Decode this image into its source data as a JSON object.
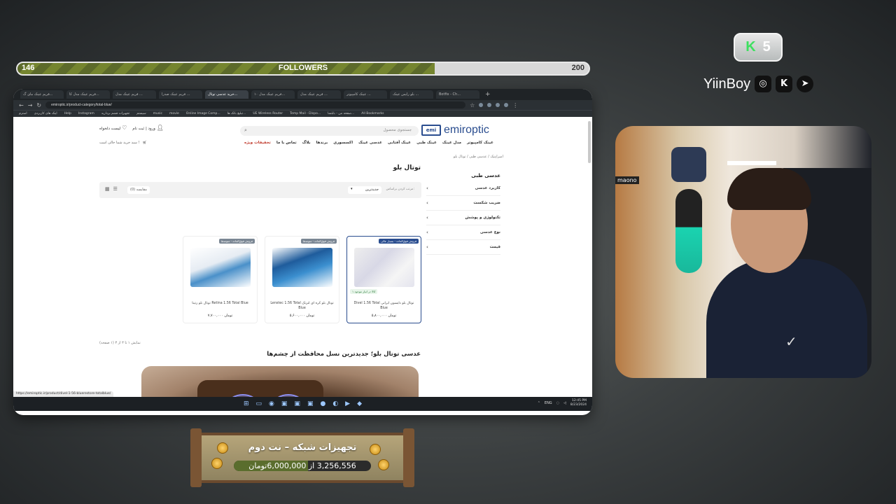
{
  "followers": {
    "current": "146",
    "goal": "200",
    "label": "FOLLOWERS",
    "progress": 0.73
  },
  "browser": {
    "tabs": [
      "فریم عینک مای گ...",
      "فریم عینک مدل کا...",
      "فریم عینک مدل ...",
      "فریم عینک صدرا ...",
      "خرید عدسی توتال...",
      "فریم عینک مدل ۱۰...",
      "فریم عینک مدل ...",
      "عینک کامپیوتر ...",
      "بلو رایس عینک ...",
      "Botfix - Ch..."
    ],
    "active_tab": 4,
    "url": "emiroptic.ir/product-category/total-blue/",
    "bookmarks": [
      "All Bookmarks",
      "صفحه من - بابلشا...",
      "Temp Mail - Dispo...",
      "UE Wireless Router",
      "تبلیغ بانک ها...",
      "Online Image Comp...",
      "movie",
      "music",
      "سیستم",
      "تجهیزات فشم بردارید",
      "Instagram",
      "Help",
      "اینک های کاربردی",
      "استرم"
    ]
  },
  "site": {
    "logo": "emiroptic",
    "logo_mark": "emi",
    "search_placeholder": "جستجوی محصول",
    "wishlist": "لیست دلخواه",
    "login": "ورود | ثبت نام",
    "cart": "سبد خرید شما خالی است !",
    "nav": [
      "عینک کامپیوتر",
      "مدل عینک",
      "عینک طبی",
      "عینک آفتابی",
      "عدسی عینک",
      "اکسسوری",
      "برندها",
      "بلاگ",
      "تماس با ما",
      "تخفیفات ویژه"
    ],
    "breadcrumb": "امیراپتیک / عدسی طبی / توتال بلو",
    "page_title": "توتال بلو",
    "sidebar_title": "عدسی طبی",
    "facets": [
      "کاربرد عدسی",
      "ضریب شکست",
      "تکنولوژی و پوشش",
      "نوع عدسی",
      "قیمت"
    ],
    "sort_label": "مرتب کردن براساس:",
    "sort_value": "جدیدترین",
    "compare": "مقایسه (0)",
    "products": [
      {
        "badge": "فروش فوق‌العاده - بسیار عالی",
        "name": "توتال بلو دایسون ایرانی Divel 1.56 Total Blue",
        "price": "۵,۸۰۰,۰۰۰ تومان",
        "stock": "۱ کالا در انبار موجود"
      },
      {
        "badge": "فروش فوق‌العاده - متوسط",
        "name": "توتال بلو کره ای لنزتک Lenstec 1.56 Total Blue",
        "price": "۵,۶۰۰,۰۰۰ تومان"
      },
      {
        "badge": "فروش فوق‌العاده - متوسط",
        "name": "Retina 1.56 Total Blue توتال بلو رتینا",
        "price": "۷,۷۰۰,۰۰۰ تومان"
      }
    ],
    "page_info": "نمایش ۱ تا ۳ از ۳ (۱ صفحه)",
    "seo_title": "عدسی توتال بلو؛ جدیدترین نسل محافظت از چشم‌ها",
    "status_url": "https://emiroptic.ir/product/divel-1-56-bluerestore-totalblue/"
  },
  "taskbar": {
    "lang": "ENG",
    "time": "12:45 PM",
    "date": "8/23/2024"
  },
  "channel": {
    "k_count": "5",
    "k_letter": "K",
    "name": "YiinBoy",
    "cam_tag": "maono"
  },
  "goal": {
    "title": "تجهیزات شبکه – نت دوم",
    "raised": "3,256,556",
    "separator": "از",
    "target": "6,000,000",
    "currency": "تومان",
    "progress": 0.54
  },
  "colors": {
    "accent": "#2a4d8f",
    "goal_fill": "#5a6d2d",
    "followers_fill": "#75852f",
    "special_red": "#c0392b"
  }
}
